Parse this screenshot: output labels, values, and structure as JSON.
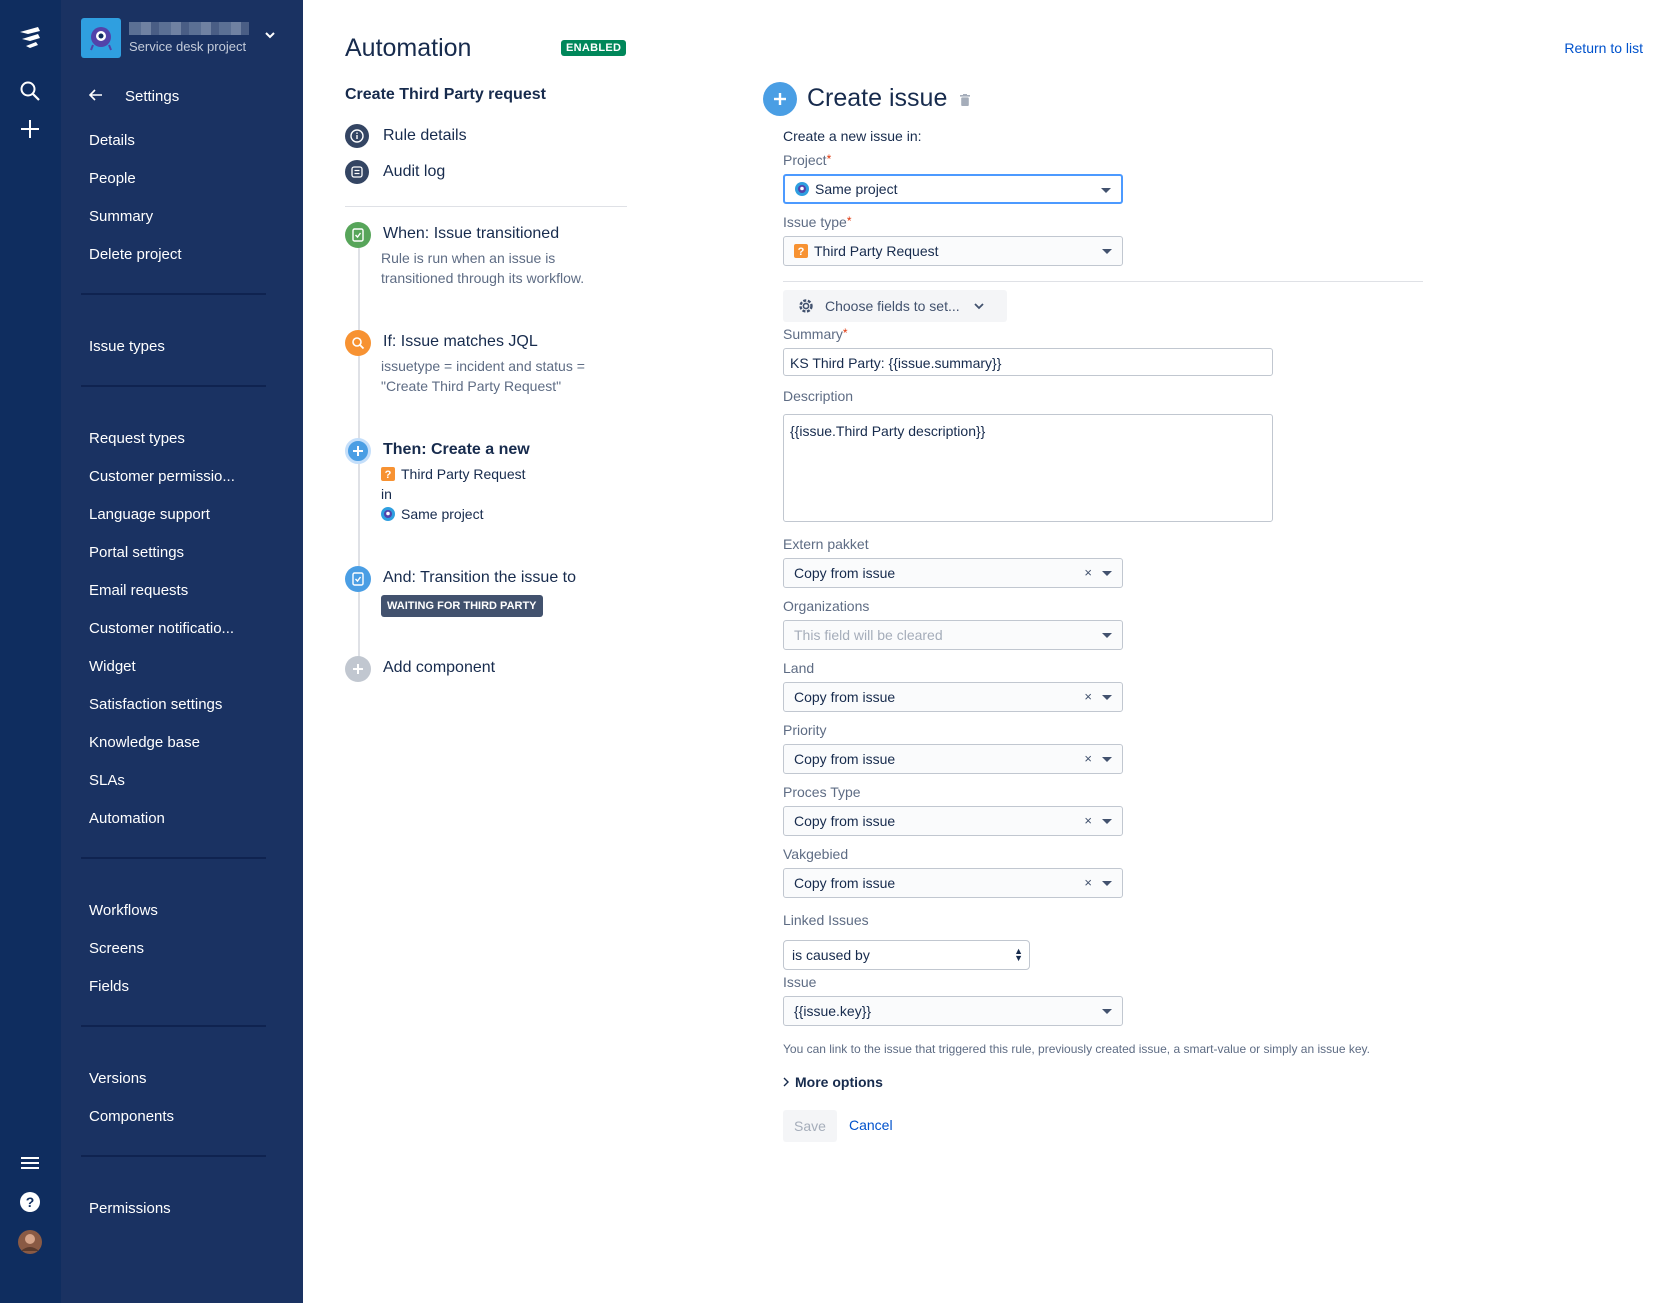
{
  "sidebar": {
    "project_type": "Service desk project",
    "settings_label": "Settings",
    "groups": [
      [
        "Details",
        "People",
        "Summary",
        "Delete project"
      ],
      [
        "Issue types"
      ],
      [
        "Request types",
        "Customer permissio...",
        "Language support",
        "Portal settings",
        "Email requests",
        "Customer notificatio...",
        "Widget",
        "Satisfaction settings",
        "Knowledge base",
        "SLAs",
        "Automation"
      ],
      [
        "Workflows",
        "Screens",
        "Fields"
      ],
      [
        "Versions",
        "Components"
      ],
      [
        "Permissions"
      ]
    ]
  },
  "header": {
    "title": "Automation",
    "status_badge": "ENABLED",
    "return_link": "Return to list"
  },
  "rule": {
    "name": "Create Third Party request",
    "links": [
      "Rule details",
      "Audit log"
    ],
    "steps": {
      "when": {
        "title": "When: Issue transitioned",
        "desc": "Rule is run when an issue is transitioned through its workflow."
      },
      "if": {
        "title": "If: Issue matches JQL",
        "desc": "issuetype = incident and status = \"Create Third Party Request\""
      },
      "then": {
        "title": "Then: Create a new",
        "issue_type": "Third Party Request",
        "in": "in",
        "project": "Same project"
      },
      "and": {
        "title": "And: Transition the issue to",
        "status": "WAITING FOR THIRD PARTY"
      },
      "add": {
        "title": "Add component"
      }
    }
  },
  "form": {
    "title": "Create issue",
    "intro": "Create a new issue in:",
    "project_label": "Project",
    "project_value": "Same project",
    "issue_type_label": "Issue type",
    "issue_type_value": "Third Party Request",
    "choose_fields": "Choose fields to set...",
    "summary_label": "Summary",
    "summary_value": "KS Third Party: {{issue.summary}}",
    "description_label": "Description",
    "description_value": "{{issue.Third Party description}}",
    "fields": [
      {
        "label": "Extern pakket",
        "value": "Copy from issue",
        "placeholder": false,
        "clearable": true
      },
      {
        "label": "Organizations",
        "value": "This field will be cleared",
        "placeholder": true,
        "clearable": false
      },
      {
        "label": "Land",
        "value": "Copy from issue",
        "placeholder": false,
        "clearable": true
      },
      {
        "label": "Priority",
        "value": "Copy from issue",
        "placeholder": false,
        "clearable": true
      },
      {
        "label": "Proces Type",
        "value": "Copy from issue",
        "placeholder": false,
        "clearable": true
      },
      {
        "label": "Vakgebied",
        "value": "Copy from issue",
        "placeholder": false,
        "clearable": true
      }
    ],
    "linked_label": "Linked Issues",
    "linked_value": "is caused by",
    "issue_label": "Issue",
    "issue_value": "{{issue.key}}",
    "hint": "You can link to the issue that triggered this rule, previously created issue, a smart-value or simply an issue key.",
    "more_options": "More options",
    "save": "Save",
    "cancel": "Cancel"
  },
  "colors": {
    "sidebar": "#1a3262",
    "global_nav": "#0f2d5f",
    "accent": "#0052cc",
    "enabled": "#00875a"
  }
}
